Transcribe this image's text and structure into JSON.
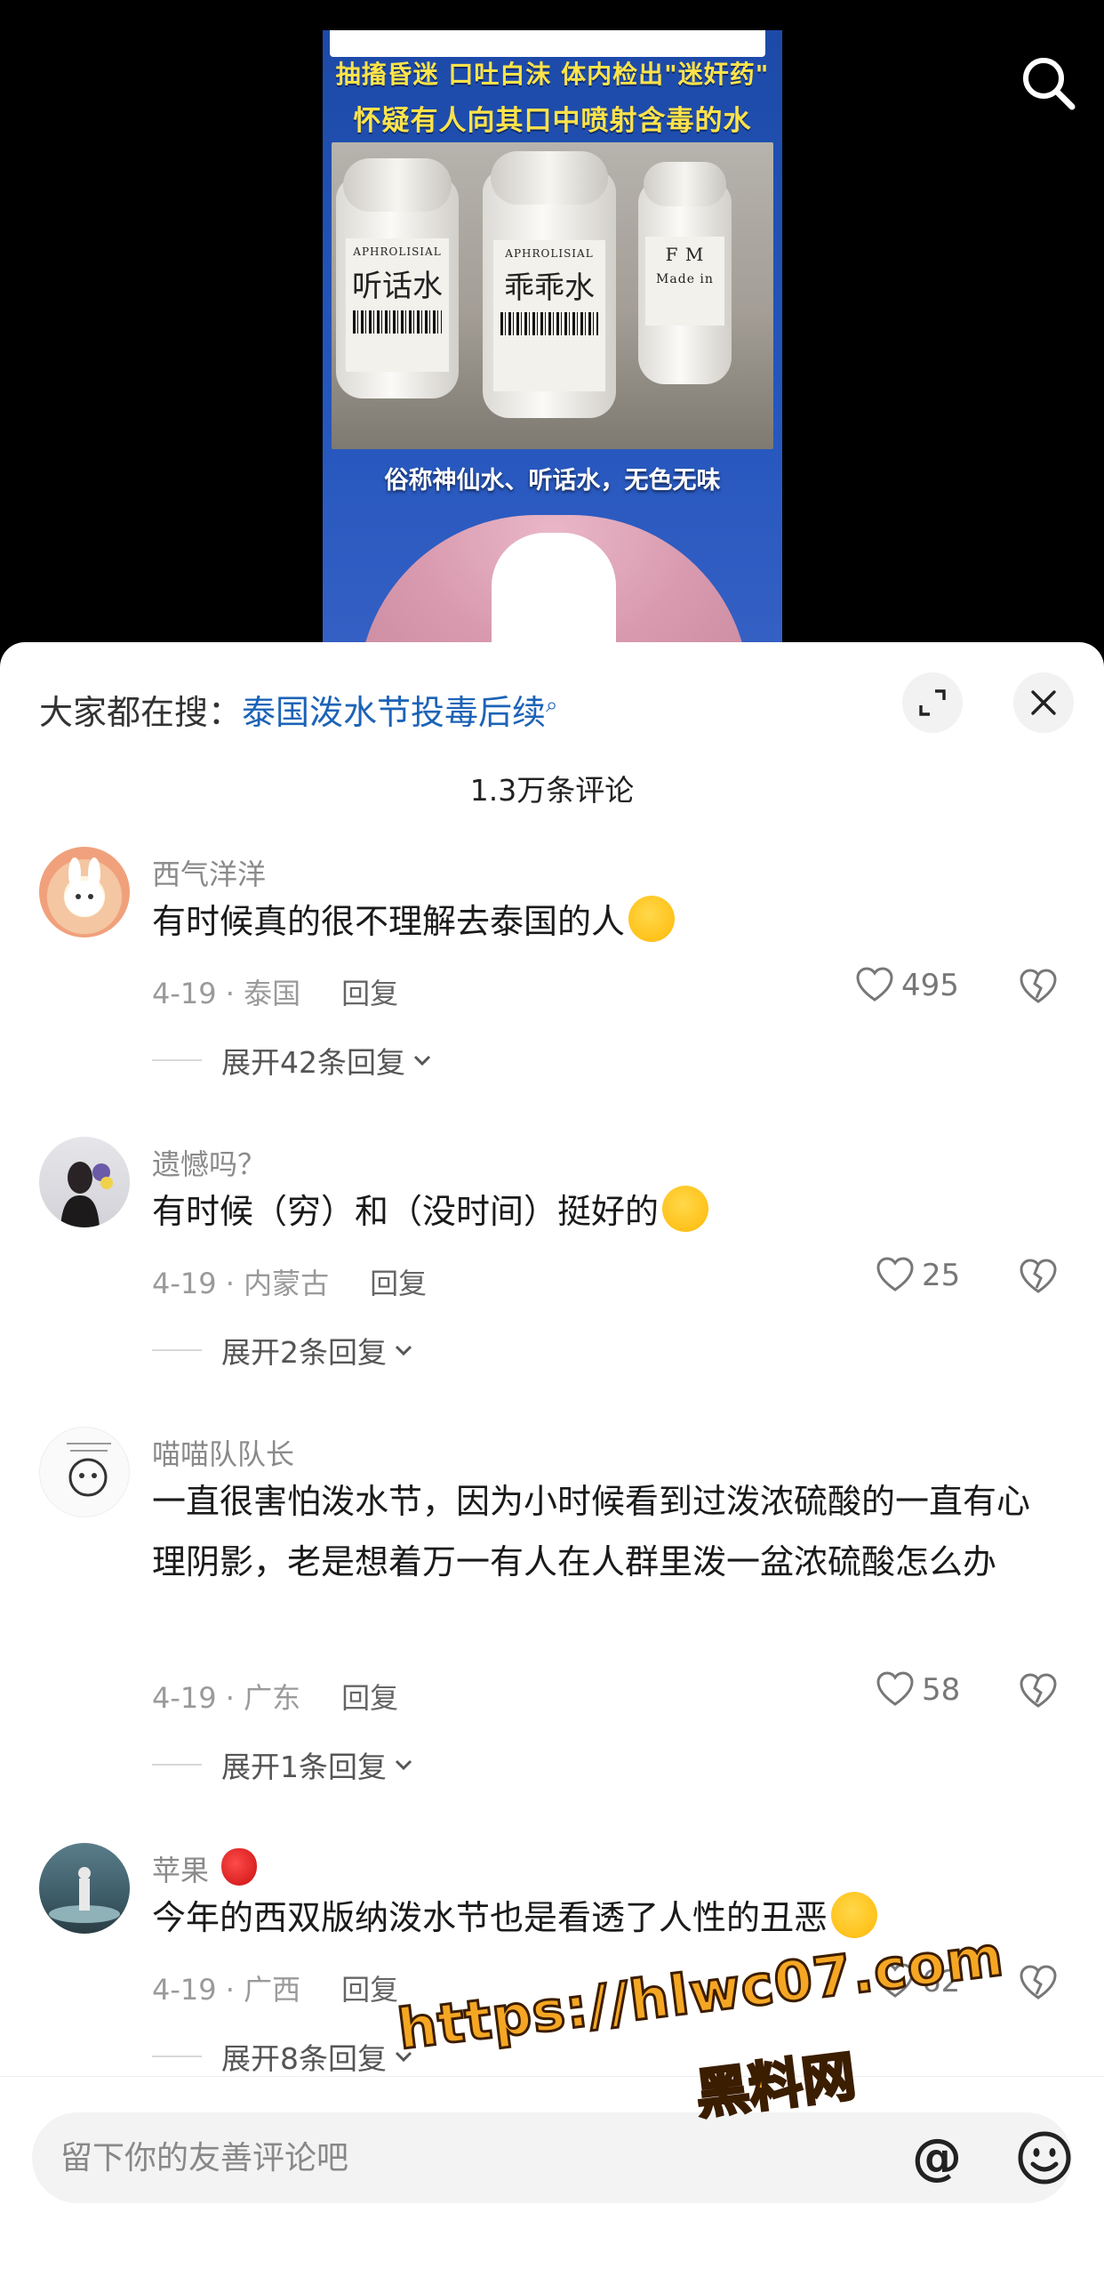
{
  "video": {
    "headline_line1": "抽搐昏迷 口吐白沫 体内检出\"迷奸药\"",
    "headline_line2": "怀疑有人向其口中喷射含毒的水",
    "bottles": [
      {
        "brand": "APHROLISIAL",
        "name": "听话水"
      },
      {
        "brand": "APHROLISIAL",
        "name": "乖乖水"
      },
      {
        "brand": "F M",
        "name": "Made in"
      }
    ],
    "caption": "俗称神仙水、听话水，无色无味",
    "search_icon": "search-icon"
  },
  "sheet": {
    "hot_search_prefix": "大家都在搜：",
    "hot_search_query": "泰国泼水节投毒后续",
    "comment_count": "1.3万条评论",
    "reply_label": "回复"
  },
  "comments": [
    {
      "username": "西气洋洋",
      "content": "有时候真的很不理解去泰国的人",
      "emoji": "crying-face",
      "date_location": "4-19 · 泰国",
      "likes": "495",
      "expand": "展开42条回复"
    },
    {
      "username": "遗憾吗？",
      "content": "有时候（穷）和（没时间）挺好的",
      "emoji": "grinning-sweat-face",
      "date_location": "4-19 · 内蒙古",
      "likes": "25",
      "expand": "展开2条回复"
    },
    {
      "username": "喵喵队队长",
      "content": "一直很害怕泼水节，因为小时候看到过泼浓硫酸的一直有心理阴影，老是想着万一有人在人群里泼一盆浓硫酸怎么办",
      "date_location": "4-19 · 广东",
      "likes": "58",
      "expand": "展开1条回复"
    },
    {
      "username": "苹果",
      "username_emoji": "apple",
      "content": "今年的西双版纳泼水节也是看透了人性的丑恶",
      "emoji": "rolling-laughing-face",
      "date_location": "4-19 · 广西",
      "likes": "62",
      "expand": "展开8条回复"
    }
  ],
  "input": {
    "placeholder": "留下你的友善评论吧",
    "at_symbol": "@"
  },
  "watermark": {
    "url": "https://hlwc07.com",
    "name": "黑料网"
  }
}
